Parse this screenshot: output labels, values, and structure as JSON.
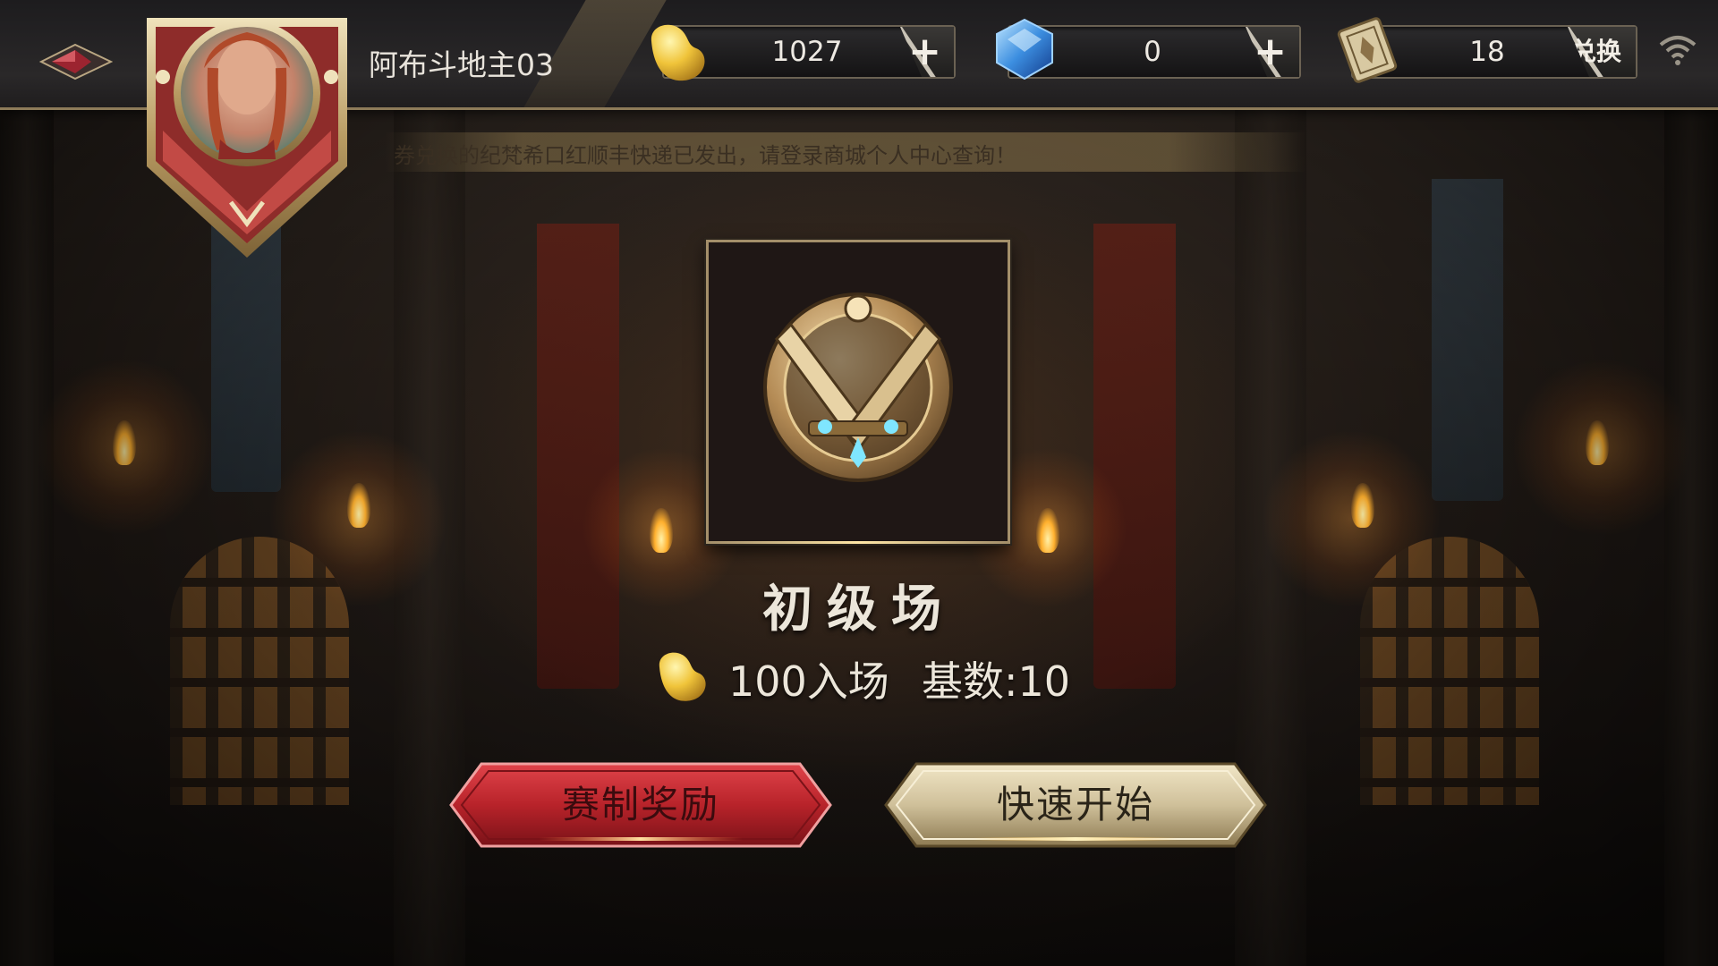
{
  "player": {
    "name": "阿布斗地主03"
  },
  "resources": {
    "beans": {
      "value": "1027",
      "action": "+"
    },
    "diamonds": {
      "value": "0",
      "action": "+"
    },
    "tickets": {
      "value": "18",
      "action": "兑换"
    }
  },
  "notice": {
    "text": "券兑换的纪梵希口红顺丰快递已发出，请登录商城个人中心查询！"
  },
  "room": {
    "title": "初级场",
    "entry": "100入场",
    "base": "基数:10"
  },
  "buttons": {
    "rules": "赛制奖励",
    "quick_start": "快速开始"
  },
  "colors": {
    "gold": "#c8a45a",
    "red_button": "#b8232a",
    "gold_button": "#cfc09a"
  }
}
